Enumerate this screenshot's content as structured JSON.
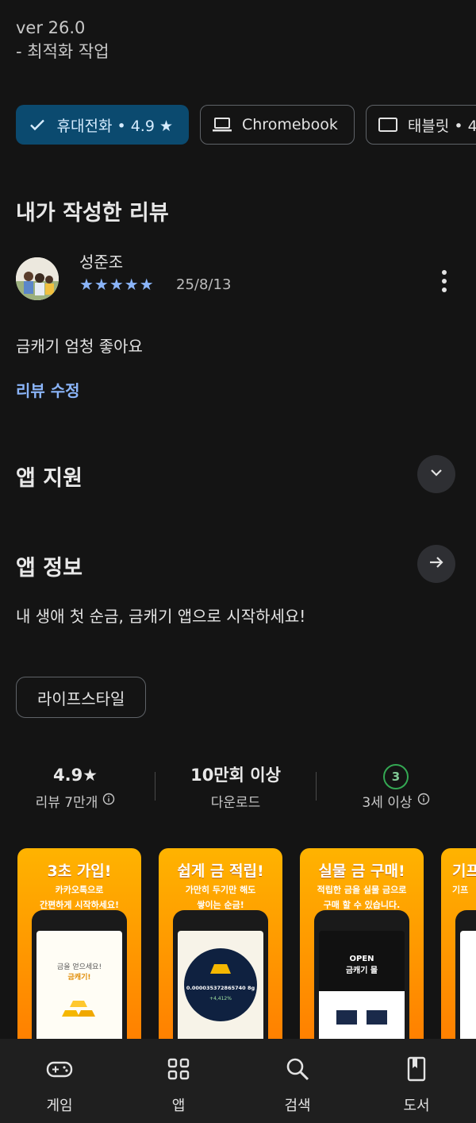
{
  "version": {
    "line1": "ver 26.0",
    "line2": "- 최적화 작업"
  },
  "device_chips": [
    {
      "label": "휴대전화 • 4.9 ★",
      "selected": true,
      "icon": "check-icon"
    },
    {
      "label": "Chromebook",
      "selected": false,
      "icon": "laptop-icon"
    },
    {
      "label": "태블릿 • 4",
      "selected": false,
      "icon": "tablet-icon"
    }
  ],
  "my_review": {
    "section_title": "내가 작성한 리뷰",
    "author": "성준조",
    "stars": "★★★★★",
    "rating": 5,
    "date": "25/8/13",
    "text": "금캐기 엄청 좋아요",
    "edit_label": "리뷰 수정"
  },
  "app_support": {
    "title": "앱 지원"
  },
  "app_info": {
    "title": "앱 정보",
    "description": "내 생애 첫 순금, 금캐기 앱으로 시작하세요!"
  },
  "category_tag": "라이프스타일",
  "stats": {
    "rating_value": "4.9★",
    "rating_label": "리뷰 7만개",
    "downloads_value": "10만회 이상",
    "downloads_label": "다운로드",
    "age_badge": "3",
    "age_label": "3세 이상"
  },
  "screenshots": [
    {
      "title": "3초 가입!",
      "sub1": "카카오톡으로",
      "sub2": "간편하게 시작하세요!",
      "screen1": "금을 얻으세요!",
      "screen2": "금캐기!"
    },
    {
      "title": "쉽게 금 적립!",
      "sub1": "가만히 두기만 해도",
      "sub2": "쌓이는 순금!",
      "screen1": "0.000035372865740 8g",
      "screen2": "+4,412%"
    },
    {
      "title": "실물 금 구매!",
      "sub1": "적립한 금을 실물 금으로",
      "sub2": "구매 할 수 있습니다.",
      "screen1": "OPEN",
      "screen2": "금캐기 몰"
    },
    {
      "title": "기프",
      "sub1": "기프",
      "sub2": "",
      "screen1": "",
      "screen2": ""
    }
  ],
  "bottom_nav": [
    {
      "label": "게임",
      "icon": "gamepad-icon"
    },
    {
      "label": "앱",
      "icon": "apps-grid-icon"
    },
    {
      "label": "검색",
      "icon": "search-icon"
    },
    {
      "label": "도서",
      "icon": "book-icon"
    }
  ],
  "colors": {
    "background": "#141414",
    "accent_blue": "#8ab4f8",
    "chip_selected": "#0b4a6f",
    "age_green": "#34a853",
    "screenshot_orange": "#ff9100"
  }
}
